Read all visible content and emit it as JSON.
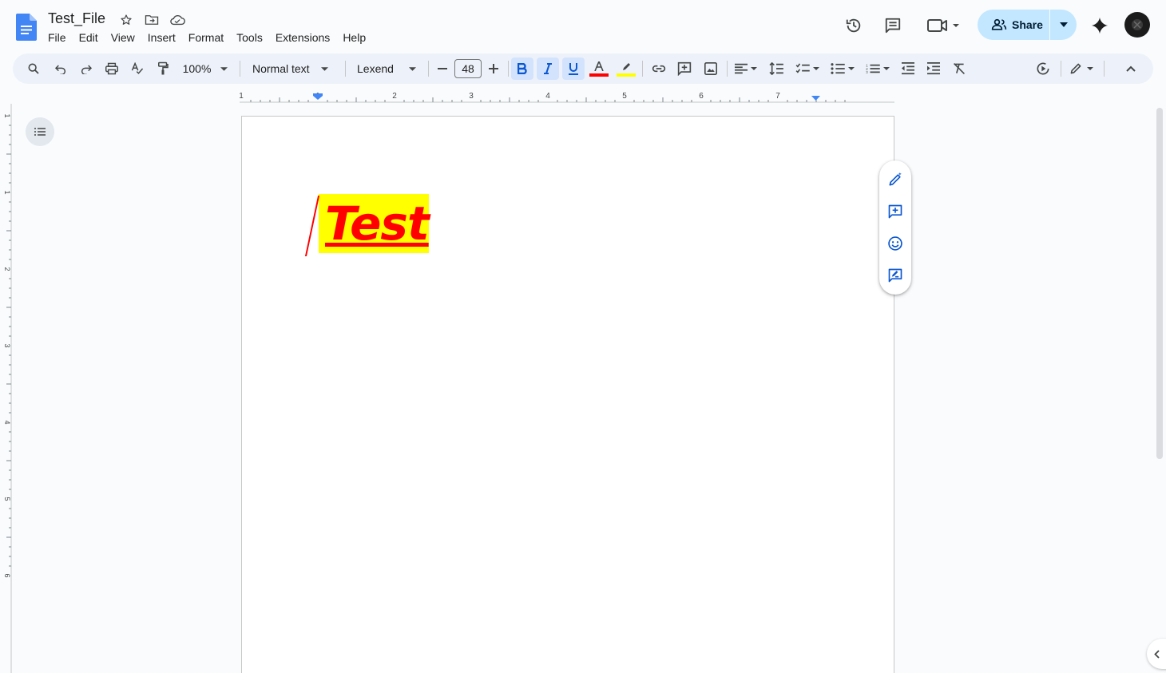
{
  "app": {
    "doc_title": "Test_File"
  },
  "menu": [
    "File",
    "Edit",
    "View",
    "Insert",
    "Format",
    "Tools",
    "Extensions",
    "Help"
  ],
  "header": {
    "share_label": "Share",
    "icons": [
      "version-history-icon",
      "comments-icon",
      "meet-icon",
      "gemini-icon",
      "avatar"
    ]
  },
  "toolbar": {
    "zoom": "100%",
    "style": "Normal text",
    "font": "Lexend",
    "font_size": "48",
    "bold_active": true,
    "italic_active": true,
    "underline_active": true,
    "text_color": "#ff0000",
    "highlight_color": "#ffff00"
  },
  "ruler": {
    "labels": [
      "1",
      "1",
      "2",
      "3",
      "4",
      "5",
      "6",
      "7"
    ],
    "vlabels": [
      "1",
      "1",
      "2",
      "3",
      "4",
      "5",
      "6"
    ]
  },
  "document": {
    "text": "Test",
    "text_color": "#ff0000",
    "highlight": "#ffff00"
  },
  "side_actions": [
    "help-me-write-icon",
    "add-comment-icon",
    "emoji-reaction-icon",
    "suggest-edits-icon"
  ]
}
